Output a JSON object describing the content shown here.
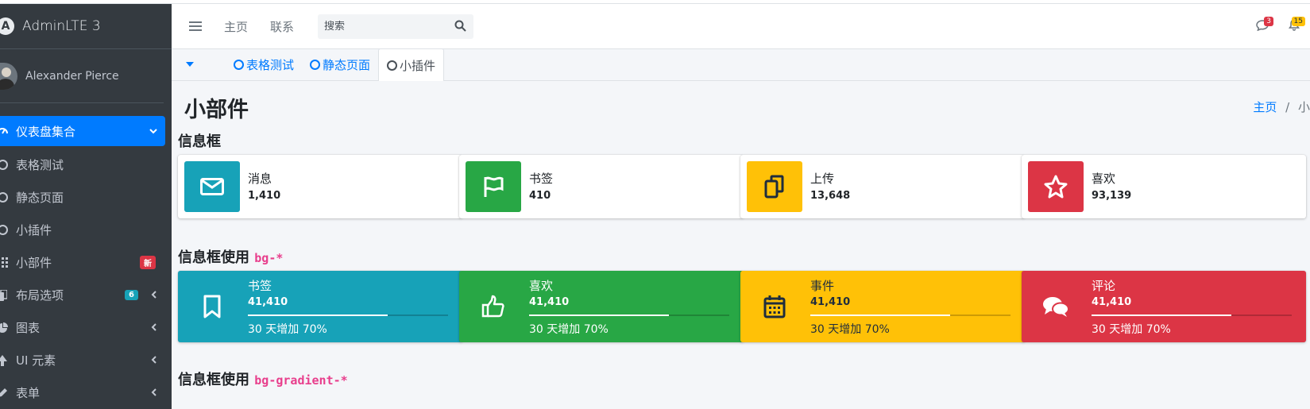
{
  "brand": {
    "title": "AdminLTE 3",
    "logo": "A"
  },
  "user": {
    "name": "Alexander Pierce"
  },
  "sidebar": {
    "items": [
      {
        "label": "仪表盘集合",
        "icon": "tachometer-icon",
        "active": true
      },
      {
        "label": "表格测试",
        "icon": "circle-icon"
      },
      {
        "label": "静态页面",
        "icon": "circle-icon"
      },
      {
        "label": "小插件",
        "icon": "circle-icon"
      },
      {
        "label": "小部件",
        "icon": "grid-icon",
        "badge": "新"
      },
      {
        "label": "布局选项",
        "icon": "copy-icon",
        "badge": "6"
      },
      {
        "label": "图表",
        "icon": "chart-pie-icon"
      },
      {
        "label": "UI 元素",
        "icon": "tree-icon"
      },
      {
        "label": "表单",
        "icon": "edit-icon"
      }
    ]
  },
  "navbar": {
    "links": [
      "主页",
      "联系"
    ],
    "search_placeholder": "搜索",
    "messages_count": "3",
    "notifications_count": "15"
  },
  "tabs": [
    "表格测试",
    "静态页面",
    "小插件"
  ],
  "page": {
    "title": "小部件",
    "breadcrumb_home": "主页",
    "breadcrumb_sep": "/",
    "breadcrumb_current": "小"
  },
  "sections": {
    "infobox_title": "信息框",
    "infobox_bg_title": "信息框使用",
    "infobox_bg_code": "bg-*",
    "infobox_gradient_title": "信息框使用",
    "infobox_gradient_code": "bg-gradient-*"
  },
  "infoboxes": [
    {
      "text": "消息",
      "number": "1,410",
      "icon": "envelope-icon",
      "color": "#17a2b8"
    },
    {
      "text": "书签",
      "number": "410",
      "icon": "flag-icon",
      "color": "#28a745"
    },
    {
      "text": "上传",
      "number": "13,648",
      "icon": "copy-icon",
      "color": "#ffc107"
    },
    {
      "text": "喜欢",
      "number": "93,139",
      "icon": "star-icon",
      "color": "#dc3545"
    }
  ],
  "infoboxes_bg": [
    {
      "text": "书签",
      "number": "41,410",
      "progress": 70,
      "desc": "30 天增加 70%",
      "icon": "bookmark-icon",
      "color": "#17a2b8"
    },
    {
      "text": "喜欢",
      "number": "41,410",
      "progress": 70,
      "desc": "30 天增加 70%",
      "icon": "thumbs-up-icon",
      "color": "#28a745"
    },
    {
      "text": "事件",
      "number": "41,410",
      "progress": 70,
      "desc": "30 天增加 70%",
      "icon": "calendar-icon",
      "color": "#ffc107"
    },
    {
      "text": "评论",
      "number": "41,410",
      "progress": 70,
      "desc": "30 天增加 70%",
      "icon": "comments-icon",
      "color": "#dc3545"
    }
  ]
}
